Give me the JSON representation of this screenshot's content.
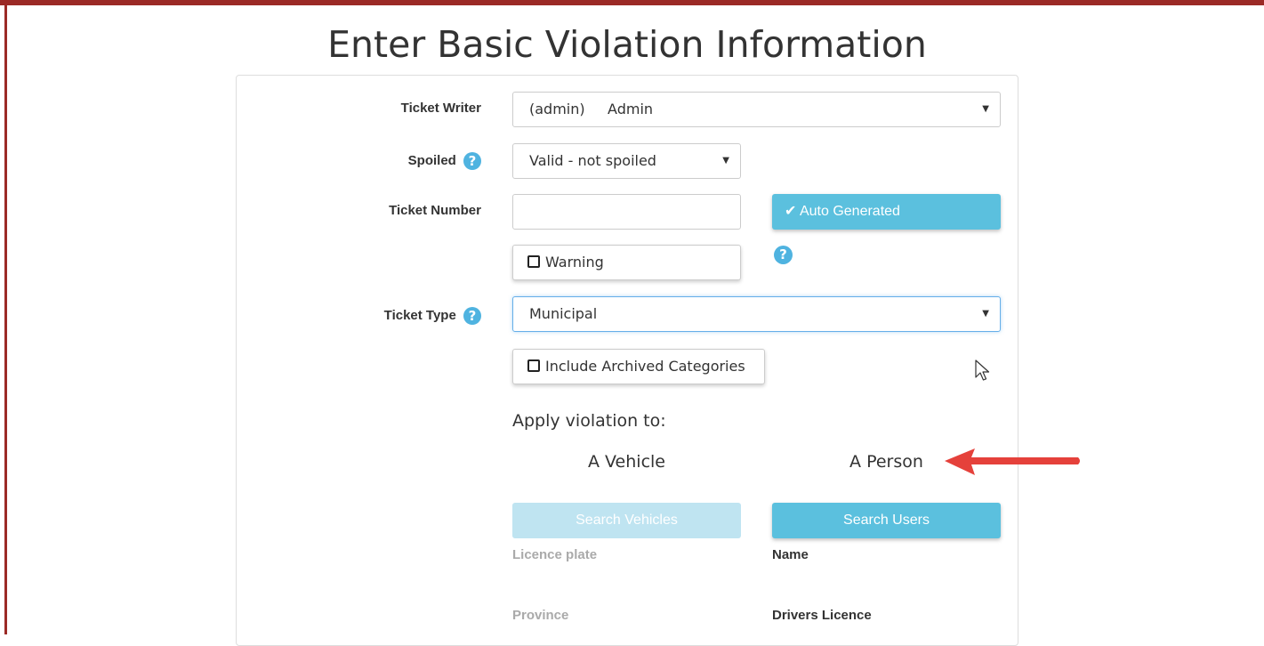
{
  "page": {
    "title": "Enter Basic Violation Information"
  },
  "form": {
    "ticket_writer": {
      "label": "Ticket Writer",
      "value": "(admin)     Admin"
    },
    "spoiled": {
      "label": "Spoiled",
      "value": "Valid - not spoiled"
    },
    "ticket_number": {
      "label": "Ticket Number",
      "value": "",
      "auto_button": "Auto Generated"
    },
    "warning": {
      "label": "Warning",
      "checked": false
    },
    "ticket_type": {
      "label": "Ticket Type",
      "value": "Municipal"
    },
    "include_archived": {
      "label": "Include Archived Categories",
      "checked": false
    }
  },
  "apply": {
    "heading": "Apply violation to:",
    "vehicle": {
      "label": "A Vehicle",
      "search_button": "Search Vehicles",
      "fields": [
        "Licence plate",
        "Province"
      ]
    },
    "person": {
      "label": "A Person",
      "search_button": "Search Users",
      "fields": [
        "Name",
        "Drivers Licence"
      ]
    }
  },
  "icons": {
    "help": "?",
    "check": "✔",
    "caret": "▼"
  },
  "colors": {
    "info": "#5bc0de",
    "info_disabled": "#bfe4f1",
    "help_icon": "#4fb3e0",
    "frame": "#9b2a26",
    "annotation_arrow": "#e5413b"
  }
}
